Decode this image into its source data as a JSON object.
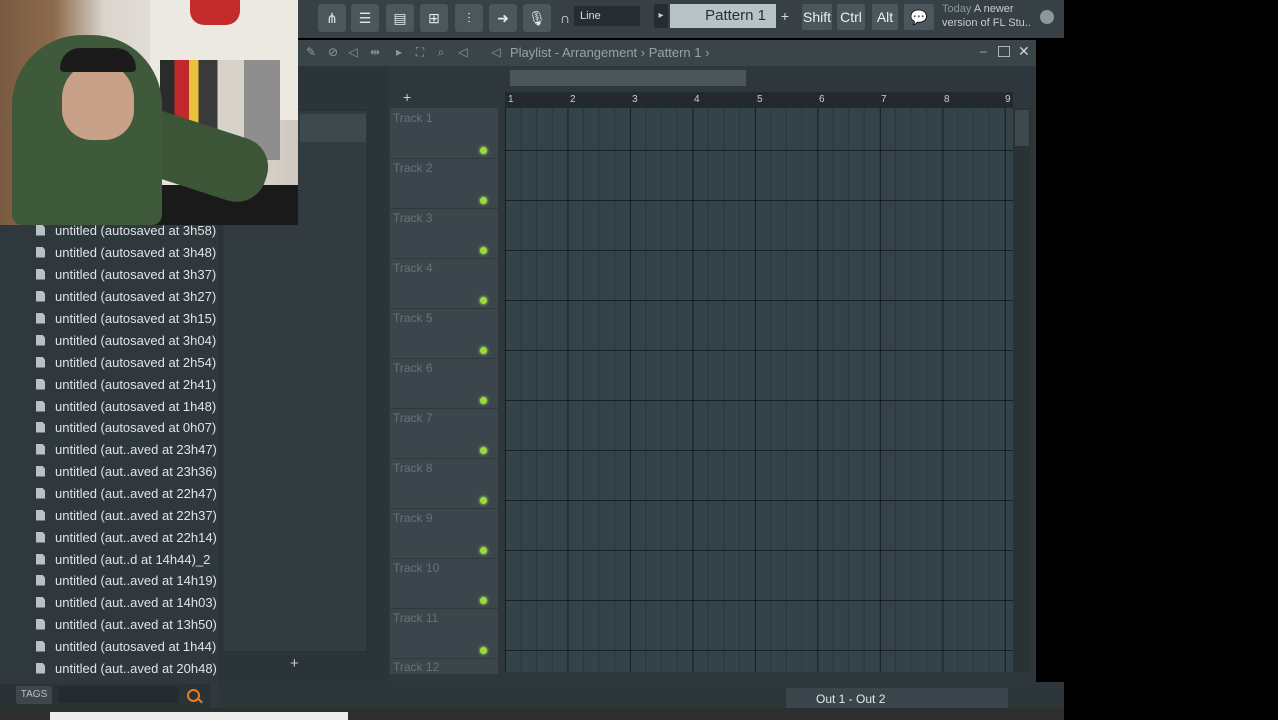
{
  "toolbar": {
    "snap_label": "Line",
    "pattern_label": "Pattern 1",
    "shift_label": "Shift",
    "ctrl_label": "Ctrl",
    "alt_label": "Alt",
    "news_day": "Today",
    "news_text_1": "A newer",
    "news_text_2": "version of FL Stu..",
    "icons": [
      "browser-icon",
      "channel-rack-icon",
      "piano-roll-icon",
      "playlist-icon",
      "mixer-icon",
      "arrow-icon",
      "mic-icon",
      "recording-icon"
    ]
  },
  "playlist": {
    "title": "Playlist - Arrangement",
    "pattern": "Pattern 1",
    "ruler": [
      "1",
      "2",
      "3",
      "4",
      "5",
      "6",
      "7",
      "8",
      "9"
    ],
    "tracks": [
      "Track 1",
      "Track 2",
      "Track 3",
      "Track 4",
      "Track 5",
      "Track 6",
      "Track 7",
      "Track 8",
      "Track 9",
      "Track 10",
      "Track 11",
      "Track 12"
    ]
  },
  "browser": {
    "files": [
      "untitled (autosaved at 3h58)",
      "untitled (autosaved at 3h48)",
      "untitled (autosaved at 3h37)",
      "untitled (autosaved at 3h27)",
      "untitled (autosaved at 3h15)",
      "untitled (autosaved at 3h04)",
      "untitled (autosaved at 2h54)",
      "untitled (autosaved at 2h41)",
      "untitled (autosaved at 1h48)",
      "untitled (autosaved at 0h07)",
      "untitled (aut..aved at 23h47)",
      "untitled (aut..aved at 23h36)",
      "untitled (aut..aved at 22h47)",
      "untitled (aut..aved at 22h37)",
      "untitled (aut..aved at 22h14)",
      "untitled (aut..d at 14h44)_2",
      "untitled (aut..aved at 14h19)",
      "untitled (aut..aved at 14h03)",
      "untitled (aut..aved at 13h50)",
      "untitled (autosaved at 1h44)",
      "untitled (aut..aved at 20h48)"
    ],
    "tags_label": "TAGS"
  },
  "bottom": {
    "output": "Out 1 - Out 2"
  },
  "colors": {
    "accent": "#e67e22",
    "led": "#9bdc3c"
  }
}
